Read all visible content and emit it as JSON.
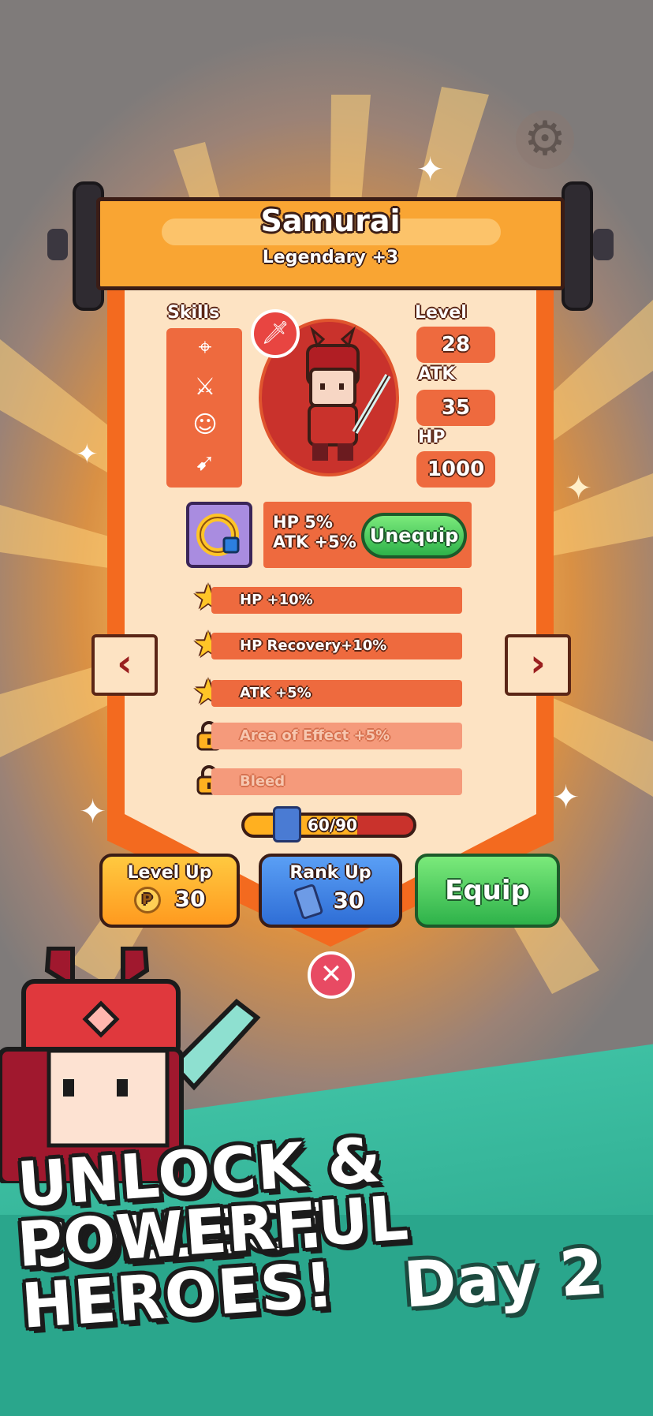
{
  "hero": {
    "name": "Samurai",
    "rarity": "Legendary +3"
  },
  "labels": {
    "skills": "Skills",
    "level": "Level",
    "atk": "ATK",
    "hp": "HP"
  },
  "stats": {
    "level": "28",
    "atk": "35",
    "hp": "1000"
  },
  "equipment": {
    "line1": "HP 5%",
    "line2": "ATK +5%",
    "unequip_label": "Unequip"
  },
  "perks": [
    {
      "label": "HP +10%",
      "unlocked": true
    },
    {
      "label": "HP Recovery+10%",
      "unlocked": true
    },
    {
      "label": "ATK +5%",
      "unlocked": true
    },
    {
      "label": "Area of Effect +5%",
      "unlocked": false
    },
    {
      "label": "Bleed",
      "unlocked": false
    }
  ],
  "progress": {
    "text": "60/90",
    "fraction": 0.667
  },
  "actions": {
    "level_up": {
      "label": "Level Up",
      "cost": "30"
    },
    "rank_up": {
      "label": "Rank Up",
      "cost": "30"
    },
    "equip": {
      "label": "Equip"
    }
  },
  "promo": {
    "line1": "UNLOCK & COLLECT",
    "line2": "POWERFUL HEROES!",
    "day": "Day 2"
  },
  "icons": {
    "settings": "gear-icon",
    "prev": "chevron-left-icon",
    "next": "chevron-right-icon",
    "close": "close-icon"
  },
  "colors": {
    "panel_orange": "#f36a1f",
    "panel_cream": "#fde3c3",
    "stat_orange": "#ee6a3e",
    "equip_green": "#2eb24a",
    "level_up_orange": "#ffa92a",
    "rank_up_blue": "#3d7ee8",
    "teal": "#2aa68c"
  }
}
